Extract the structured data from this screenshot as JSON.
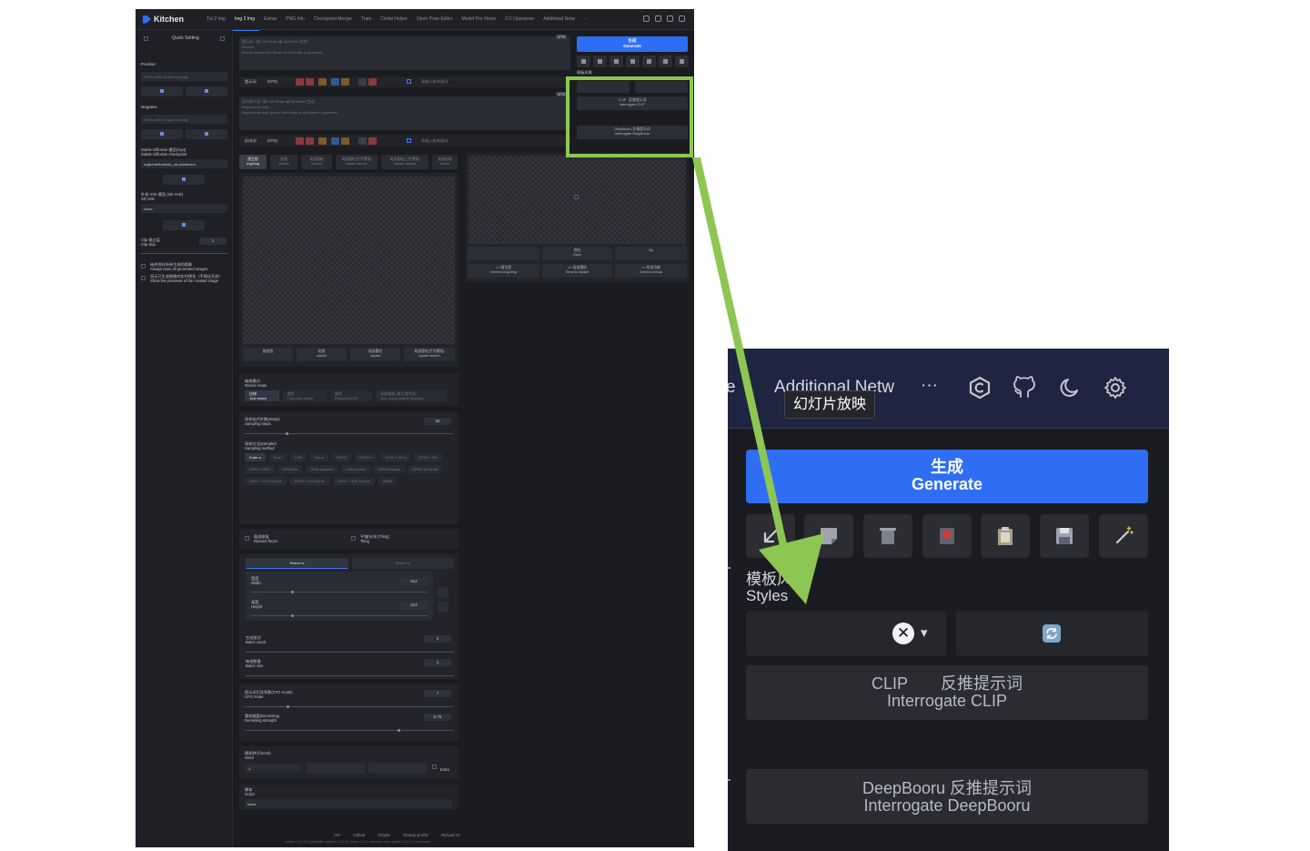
{
  "app": {
    "title": "Kitchen",
    "tabs": [
      "Txt 2 Img",
      "Img 2 Img",
      "Extras",
      "PNG Info",
      "Checkpoint Merger",
      "Train",
      "Civitai Helper",
      "Open Pose Editor",
      "Model Pre Views",
      "3 D Openpose",
      "Additional Netw",
      "···"
    ],
    "active_tab": "Img 2 Img"
  },
  "sidebar": {
    "header": "Quick Setting",
    "positive_label": "Positive",
    "positive_placeholder": "Press enter to add new tag",
    "negative_label": "Negative",
    "negative_placeholder": "Press enter to add new tag",
    "checkpoint_label_cn": "Stable Diffusion 模型(ckpt)",
    "checkpoint_label_en": "Stable Diffusion checkpoint",
    "checkpoint_value": "majicmixRealistic_v6.safetensor",
    "vae_label_cn": "外挂 VAE 模型 (SD VAE)",
    "vae_label_en": "SD VAE",
    "vae_value": "None",
    "clip_label_cn": "Clip 跳过层",
    "clip_label_en": "Clip skip",
    "clip_value": "1",
    "opt1_cn": "始终保存所有生成的图像",
    "opt1_en": "Always save all generated images",
    "opt2_cn": "显示已生成图像的实时预览（不建议开启）",
    "opt2_en": "Show live previews of the created image"
  },
  "prompt": {
    "placeholder_cn": "提示词（按 Ctrl+Enter 或 Alt+Enter 生成）",
    "placeholder_sub": "Prompt",
    "placeholder_en": "Prompt (press Ctrl+Enter or Alt+Enter to generate)",
    "counter": "0/75",
    "label": "提示词",
    "label_count": "(0/75)",
    "tag_placeholder": "请输入新关键词"
  },
  "negative_prompt": {
    "placeholder_cn": "反向提示词（按 Ctrl+Enter 或 Alt+Enter 生成）",
    "placeholder_sub": "Negative prompt",
    "placeholder_en": "Negative prompt (press Ctrl+Enter or Alt+Enter to generate)",
    "counter": "0/75",
    "label": "反向词",
    "label_count": "(0/75)",
    "tag_placeholder": "请输入新关键词"
  },
  "right_mini": {
    "generate_cn": "生成",
    "generate_en": "Generate",
    "styles_label": "模板风格",
    "clip_cn": "CLIP",
    "clip_cn2": "反推提示词",
    "clip_en": "Interrogate CLIP",
    "deepbooru_cn": "DeepBooru 反推提示词",
    "deepbooru_en": "Interrogate DeepBooru"
  },
  "img_tabs": [
    {
      "cn": "图生图",
      "en": "img2img"
    },
    {
      "cn": "绘图",
      "en": "Sketch"
    },
    {
      "cn": "局部重绘",
      "en": "Inpaint"
    },
    {
      "cn": "局部重绘(手涂蒙版)",
      "en": "Inpaint sketch"
    },
    {
      "cn": "局部重绘(上传蒙版)",
      "en": "Inpaint upload"
    },
    {
      "cn": "批量处理",
      "en": "Batch"
    }
  ],
  "copy_to": [
    {
      "cn": "复制到",
      "en": ""
    },
    {
      "cn": "绘图",
      "en": "sketch"
    },
    {
      "cn": "局部重绘",
      "en": "inpaint"
    },
    {
      "cn": "局部重绘(手涂蒙版)",
      "en": "inpaint sketch"
    }
  ],
  "output_buttons": [
    {
      "cn": "",
      "en": ""
    },
    {
      "cn": "保存",
      "en": "Save"
    },
    {
      "cn": "",
      "en": "Zip"
    },
    {
      "cn": ">> 图生图",
      "en": "Send to img2img"
    },
    {
      "cn": ">> 局部重绘",
      "en": "Send to inpaint"
    },
    {
      "cn": ">> 附加功能",
      "en": "Send to extras"
    }
  ],
  "resize": {
    "label_cn": "缩放模式",
    "label_en": "Resize mode",
    "modes": [
      {
        "cn": "拉伸",
        "en": "Just resize"
      },
      {
        "cn": "裁剪",
        "en": "Crop and resize"
      },
      {
        "cn": "填充",
        "en": "Resize and fill"
      },
      {
        "cn": "直接缩放 (放大潜空间)",
        "en": "Just resize (latent upscale)"
      }
    ]
  },
  "sampling": {
    "steps_label_cn": "采样迭代步数(Steps)",
    "steps_label_en": "Sampling steps",
    "steps_value": "20",
    "steps_fraction": 0.2,
    "method_label_cn": "采样方法(Sampler)",
    "method_label_en": "Sampling method",
    "samplers": [
      "Euler a",
      "Euler",
      "LMS",
      "Heun",
      "DPM2",
      "DPM2 a",
      "DPM++ 2S a",
      "DPM++ 2M",
      "DPM++ SDE",
      "DPM fast",
      "DPM adaptive",
      "LMS Karras",
      "DPM2 Karras",
      "DPM2 a Karras",
      "DPM++ 2S a Karras",
      "DPM++ 2M Karras",
      "DPM++ SDE Karras",
      "DDIM"
    ],
    "selected": "Euler a"
  },
  "options": {
    "restore_cn": "面部修复",
    "restore_en": "Restore faces",
    "tiling_cn": "平铺/分块 (Tiling)",
    "tiling_en": "Tiling"
  },
  "size": {
    "tab_resize_to": "Resize to",
    "tab_resize_by": "Resize by",
    "width_cn": "宽度",
    "width_en": "Width",
    "width_value": "512",
    "height_cn": "高度",
    "height_en": "Height",
    "height_value": "512",
    "batch_count_cn": "生成批次",
    "batch_count_en": "Batch count",
    "batch_count_value": "1",
    "batch_size_cn": "每批数量",
    "batch_size_en": "Batch size",
    "batch_size_value": "1"
  },
  "cfg": {
    "label_cn": "提示词引导系数(CFG Scale)",
    "label_en": "CFG Scale",
    "value": "7",
    "denoise_cn": "重绘幅度(Denoising)",
    "denoise_en": "Denoising strength",
    "denoise_value": "0.75"
  },
  "seed": {
    "label_cn": "随机种子(seed)",
    "label_en": "Seed",
    "value": "-1",
    "extra": "Extra"
  },
  "script": {
    "label_cn": "脚本",
    "label_en": "Script",
    "value": "None"
  },
  "footer": {
    "links": [
      "API",
      "Github",
      "Gradio",
      "Startup profile",
      "Reload UI"
    ],
    "version_line": "version: v1.6.0-2-g4afaaf8a  •  python: 3.10.11  •  torch: 2.0.1  •  xformers: N/A  •  gradio: 3.41.2  •  checkpoint: ..."
  },
  "zoom": {
    "nav_partial": "e",
    "nav_tab": "Additional Netw",
    "more": "···",
    "tooltip": "幻灯片放映",
    "generate_cn": "生成",
    "generate_en": "Generate",
    "styles_cn": "模板风",
    "styles_en": "Styles",
    "clear_symbol": "✕",
    "dropdown_symbol": "▾",
    "clip_cn": "CLIP",
    "clip_cn2": "反推提示词",
    "clip_en": "Interrogate CLIP",
    "deepbooru_cn": "DeepBooru 反推提示词",
    "deepbooru_en": "Interrogate DeepBooru",
    "tools": [
      "arrow-down-left-icon",
      "sticky-note-icon",
      "trash-icon",
      "record-icon",
      "clipboard-icon",
      "save-icon",
      "magic-wand-icon"
    ],
    "nav_icons": [
      "civitai-icon",
      "github-icon",
      "moon-icon",
      "gear-icon"
    ]
  },
  "colors": {
    "accent": "#2f6ef3",
    "highlight": "#8dc653",
    "background_dark": "#1b1c20"
  }
}
